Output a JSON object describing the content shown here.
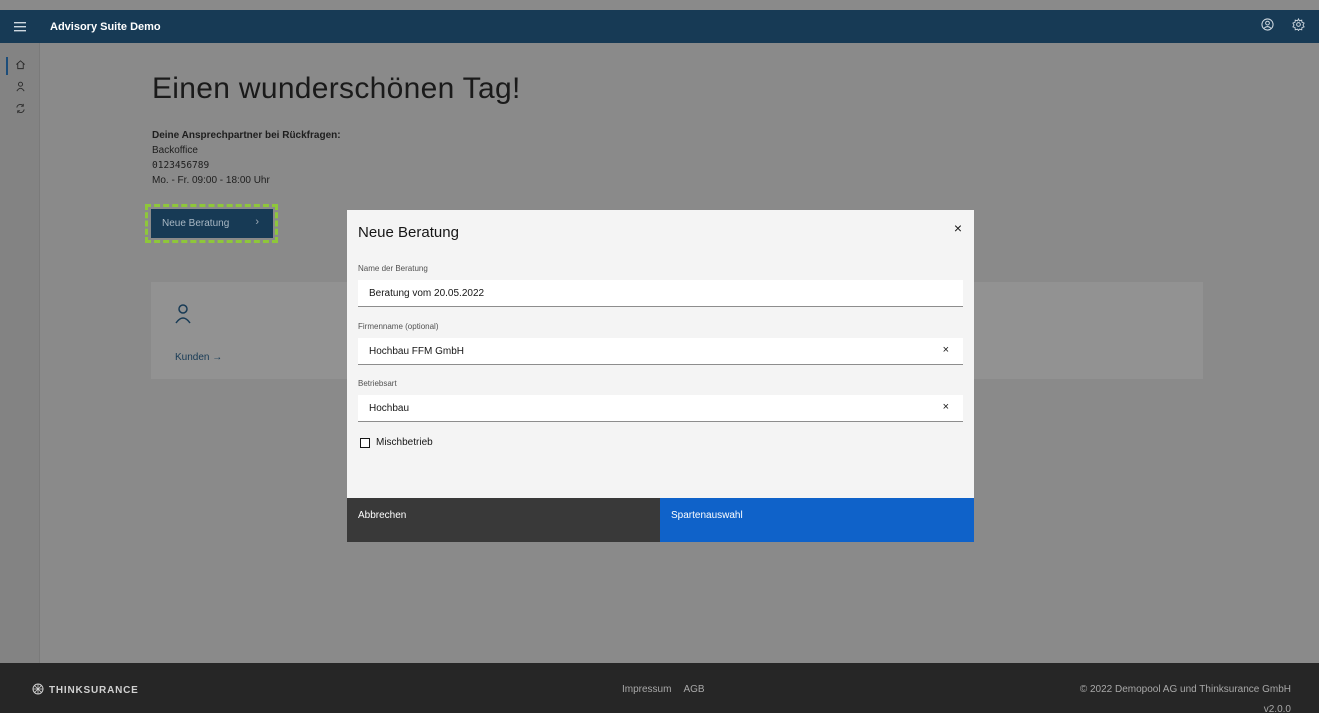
{
  "app": {
    "title": "Advisory Suite Demo"
  },
  "topbar": {
    "menu_icon": "hamburger-icon",
    "icons": [
      "user-circle-icon",
      "settings-gear-icon"
    ]
  },
  "rail": {
    "items": [
      {
        "icon": "home-icon",
        "active": true
      },
      {
        "icon": "user-icon",
        "active": false
      },
      {
        "icon": "recycle-icon",
        "active": false
      }
    ]
  },
  "home": {
    "greeting": "Einen wunderschönen Tag!",
    "contact_heading": "Deine Ansprechpartner bei Rückfragen:",
    "contact_name": "Backoffice",
    "contact_phone": "0123456789",
    "contact_hours": "Mo. - Fr. 09:00 - 18:00 Uhr",
    "new_button": "Neue Beratung",
    "kunden_link": "Kunden →"
  },
  "modal": {
    "title": "Neue Beratung",
    "close": "×",
    "fields": [
      {
        "label": "Name der Beratung",
        "value": "Beratung vom 20.05.2022",
        "clearable": false
      },
      {
        "label": "Firmenname (optional)",
        "value": "Hochbau FFM GmbH",
        "clearable": true
      },
      {
        "label": "Betriebsart",
        "value": "Hochbau",
        "clearable": true
      }
    ],
    "checkbox_label": "Mischbetrieb",
    "checkbox_checked": false,
    "cancel": "Abbrechen",
    "primary": "Spartenauswahl"
  },
  "footer": {
    "brand": "THINKSURANCE",
    "links": [
      "Impressum",
      "AGB"
    ],
    "copyright": "© 2022 Demopool AG und Thinksurance GmbH",
    "version": "v2.0.0"
  },
  "colors": {
    "topbar": "#173a55",
    "primary": "#0f62c9",
    "highlight": "#8ec73a",
    "footer": "#262626"
  }
}
